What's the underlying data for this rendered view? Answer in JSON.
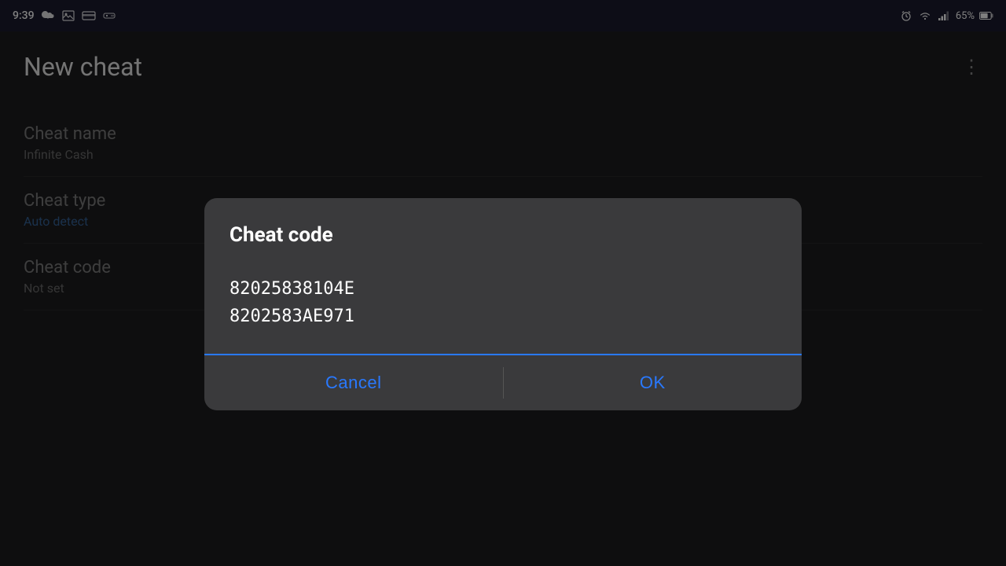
{
  "statusBar": {
    "time": "9:39",
    "battery": "65%",
    "icons": [
      "cloud-sync-icon",
      "image-icon",
      "card-icon",
      "android-icon"
    ]
  },
  "appBar": {
    "title": "New cheat",
    "moreIcon": "⋮"
  },
  "formSections": [
    {
      "label": "Cheat name",
      "value": "Infinite Cash",
      "valueClass": ""
    },
    {
      "label": "Cheat type",
      "value": "Auto detect",
      "valueClass": "blue"
    },
    {
      "label": "Cheat code",
      "value": "Not set",
      "valueClass": ""
    }
  ],
  "dialog": {
    "title": "Cheat code",
    "codeLines": [
      "82025838104E",
      "8202583AE971"
    ],
    "cancelLabel": "Cancel",
    "okLabel": "OK"
  }
}
